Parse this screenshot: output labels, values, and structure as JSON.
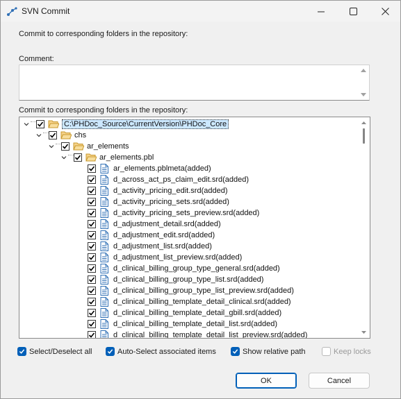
{
  "window": {
    "title": "SVN Commit"
  },
  "dialog": {
    "header_text": "Commit to corresponding folders in the repository:",
    "comment_label": "Comment:",
    "comment_value": "",
    "tree_label": "Commit to corresponding folders in the repository:"
  },
  "tree": {
    "root": "C:\\PHDoc_Source\\CurrentVersion\\PHDoc_Core",
    "level1": "chs",
    "level2": "ar_elements",
    "level3": "ar_elements.pbl",
    "files": [
      "ar_elements.pblmeta(added)",
      "d_across_act_ps_claim_edit.srd(added)",
      "d_activity_pricing_edit.srd(added)",
      "d_activity_pricing_sets.srd(added)",
      "d_activity_pricing_sets_preview.srd(added)",
      "d_adjustment_detail.srd(added)",
      "d_adjustment_edit.srd(added)",
      "d_adjustment_list.srd(added)",
      "d_adjustment_list_preview.srd(added)",
      "d_clinical_billing_group_type_general.srd(added)",
      "d_clinical_billing_group_type_list.srd(added)",
      "d_clinical_billing_group_type_list_preview.srd(added)",
      "d_clinical_billing_template_detail_clinical.srd(added)",
      "d_clinical_billing_template_detail_gbill.srd(added)",
      "d_clinical_billing_template_detail_list.srd(added)",
      "d_clinical_billing_template_detail_list_preview.srd(added)"
    ]
  },
  "options": {
    "select_all": "Select/Deselect all",
    "auto_select": "Auto-Select associated items",
    "show_relative": "Show relative path",
    "keep_locks": "Keep locks"
  },
  "buttons": {
    "ok": "OK",
    "cancel": "Cancel"
  },
  "colors": {
    "accent": "#005fb8",
    "selection": "#cce8ff",
    "folder": "#e8b64c"
  }
}
